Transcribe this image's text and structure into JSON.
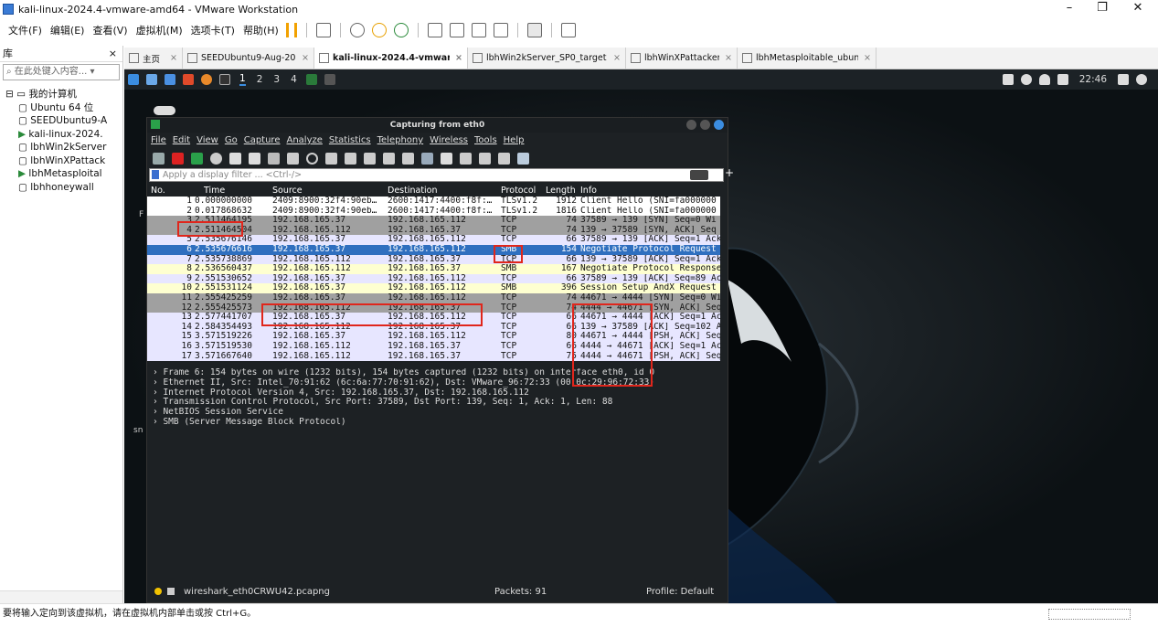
{
  "window": {
    "title": "kali-linux-2024.4-vmware-amd64 - VMware Workstation",
    "minimize": "–",
    "maximize": "❐",
    "close": "✕"
  },
  "menu": [
    "文件(F)",
    "编辑(E)",
    "查看(V)",
    "虚拟机(M)",
    "选项卡(T)",
    "帮助(H)"
  ],
  "library": {
    "title": "库",
    "close": "×",
    "search_placeholder": "在此处键入内容...",
    "root": "我的计算机",
    "items": [
      "Ubuntu 64 位",
      "SEEDUbuntu9-A",
      "kali-linux-2024.",
      "lbhWin2kServer",
      "lbhWinXPattack",
      "lbhMetasploital",
      "lbhhoneywall"
    ]
  },
  "tabs": [
    {
      "label": "主页",
      "active": false
    },
    {
      "label": "SEEDUbuntu9-Aug-2010",
      "active": false
    },
    {
      "label": "kali-linux-2024.4-vmware-a...",
      "active": true
    },
    {
      "label": "lbhWin2kServer_SP0_target",
      "active": false
    },
    {
      "label": "lbhWinXPattacker",
      "active": false
    },
    {
      "label": "lbhMetasploitable_ubuntu",
      "active": false
    }
  ],
  "kali_bar": {
    "workspaces": [
      "1",
      "2",
      "3",
      "4"
    ],
    "clock": "22:46"
  },
  "wireshark": {
    "title": "Capturing from eth0",
    "menu": [
      "File",
      "Edit",
      "View",
      "Go",
      "Capture",
      "Analyze",
      "Statistics",
      "Telephony",
      "Wireless",
      "Tools",
      "Help"
    ],
    "filter_placeholder": "Apply a display filter ... <Ctrl-/>",
    "add_filter": "+",
    "columns": [
      "No.",
      "Time",
      "Source",
      "Destination",
      "Protocol",
      "Length",
      "Info"
    ],
    "details": [
      "Frame 6: 154 bytes on wire (1232 bits), 154 bytes captured (1232 bits) on interface eth0, id 0",
      "Ethernet II, Src: Intel_70:91:62 (6c:6a:77:70:91:62), Dst: VMware_96:72:33 (00:0c:29:96:72:33)",
      "Internet Protocol Version 4, Src: 192.168.165.37, Dst: 192.168.165.112",
      "Transmission Control Protocol, Src Port: 37589, Dst Port: 139, Seq: 1, Ack: 1, Len: 88",
      "NetBIOS Session Service",
      "SMB (Server Message Block Protocol)"
    ],
    "status_file": "wireshark_eth0CRWU42.pcapng",
    "status_packets": "Packets: 91",
    "status_profile": "Profile: Default"
  },
  "bg_fragments": {
    "f": "F",
    "sn": "sn"
  },
  "chart_data": {
    "type": "table",
    "columns": [
      "No.",
      "Time",
      "Source",
      "Destination",
      "Protocol",
      "Length",
      "Info"
    ],
    "rows": [
      {
        "no": "1",
        "time": "0.000000000",
        "src": "2409:8900:32f4:90eb…",
        "dst": "2600:1417:4400:f8f:…",
        "proto": "TLSv1.2",
        "len": "1912",
        "info": "Client Hello (SNI=fa000000",
        "bg": "#ffffff"
      },
      {
        "no": "2",
        "time": "0.017868632",
        "src": "2409:8900:32f4:90eb…",
        "dst": "2600:1417:4400:f8f:…",
        "proto": "TLSv1.2",
        "len": "1816",
        "info": "Client Hello (SNI=fa000000",
        "bg": "#ffffff"
      },
      {
        "no": "3",
        "time": "2.511464195",
        "src": "192.168.165.37",
        "dst": "192.168.165.112",
        "proto": "TCP",
        "len": "74",
        "info": "37589 → 139 [SYN] Seq=0 Wi",
        "bg": "#a0a0a0"
      },
      {
        "no": "4",
        "time": "2.511464504",
        "src": "192.168.165.112",
        "dst": "192.168.165.37",
        "proto": "TCP",
        "len": "74",
        "info": "139 → 37589 [SYN, ACK] Seq",
        "bg": "#a0a0a0"
      },
      {
        "no": "5",
        "time": "2.535676146",
        "src": "192.168.165.37",
        "dst": "192.168.165.112",
        "proto": "TCP",
        "len": "66",
        "info": "37589 → 139 [ACK] Seq=1 Ack",
        "bg": "#e7e6ff"
      },
      {
        "no": "6",
        "time": "2.535676616",
        "src": "192.168.165.37",
        "dst": "192.168.165.112",
        "proto": "SMB",
        "len": "154",
        "info": "Negotiate Protocol Request",
        "bg": "#2f6fbf",
        "fg": "#ffffff"
      },
      {
        "no": "7",
        "time": "2.535738869",
        "src": "192.168.165.112",
        "dst": "192.168.165.37",
        "proto": "TCP",
        "len": "66",
        "info": "139 → 37589 [ACK] Seq=1 Ack",
        "bg": "#e7e6ff"
      },
      {
        "no": "8",
        "time": "2.536560437",
        "src": "192.168.165.112",
        "dst": "192.168.165.37",
        "proto": "SMB",
        "len": "167",
        "info": "Negotiate Protocol Response",
        "bg": "#feffd0"
      },
      {
        "no": "9",
        "time": "2.551530652",
        "src": "192.168.165.37",
        "dst": "192.168.165.112",
        "proto": "TCP",
        "len": "66",
        "info": "37589 → 139 [ACK] Seq=89 Ac",
        "bg": "#e7e6ff"
      },
      {
        "no": "10",
        "time": "2.551531124",
        "src": "192.168.165.37",
        "dst": "192.168.165.112",
        "proto": "SMB",
        "len": "396",
        "info": "Session Setup AndX Request",
        "bg": "#feffd0"
      },
      {
        "no": "11",
        "time": "2.555425259",
        "src": "192.168.165.37",
        "dst": "192.168.165.112",
        "proto": "TCP",
        "len": "74",
        "info": "44671 → 4444 [SYN] Seq=0 Wi",
        "bg": "#a0a0a0"
      },
      {
        "no": "12",
        "time": "2.555425573",
        "src": "192.168.165.112",
        "dst": "192.168.165.37",
        "proto": "TCP",
        "len": "74",
        "info": "4444 → 44671 [SYN, ACK] Seq",
        "bg": "#a0a0a0"
      },
      {
        "no": "13",
        "time": "2.577441707",
        "src": "192.168.165.37",
        "dst": "192.168.165.112",
        "proto": "TCP",
        "len": "66",
        "info": "44671 → 4444 [ACK] Seq=1 Ac",
        "bg": "#e7e6ff"
      },
      {
        "no": "14",
        "time": "2.584354493",
        "src": "192.168.165.112",
        "dst": "192.168.165.37",
        "proto": "TCP",
        "len": "66",
        "info": "139 → 37589 [ACK] Seq=102 A",
        "bg": "#e7e6ff"
      },
      {
        "no": "15",
        "time": "3.571519226",
        "src": "192.168.165.37",
        "dst": "192.168.165.112",
        "proto": "TCP",
        "len": "80",
        "info": "44671 → 4444 [PSH, ACK] Seq",
        "bg": "#e7e6ff"
      },
      {
        "no": "16",
        "time": "3.571519530",
        "src": "192.168.165.112",
        "dst": "192.168.165.37",
        "proto": "TCP",
        "len": "66",
        "info": "4444 → 44671 [ACK] Seq=1 Ac",
        "bg": "#e7e6ff"
      },
      {
        "no": "17",
        "time": "3.571667640",
        "src": "192.168.165.112",
        "dst": "192.168.165.37",
        "proto": "TCP",
        "len": "75",
        "info": "4444 → 44671 [PSH, ACK] Seq",
        "bg": "#e7e6ff"
      }
    ]
  },
  "status_hint": "要将输入定向到该虚拟机，请在虚拟机内部单击或按 Ctrl+G。"
}
